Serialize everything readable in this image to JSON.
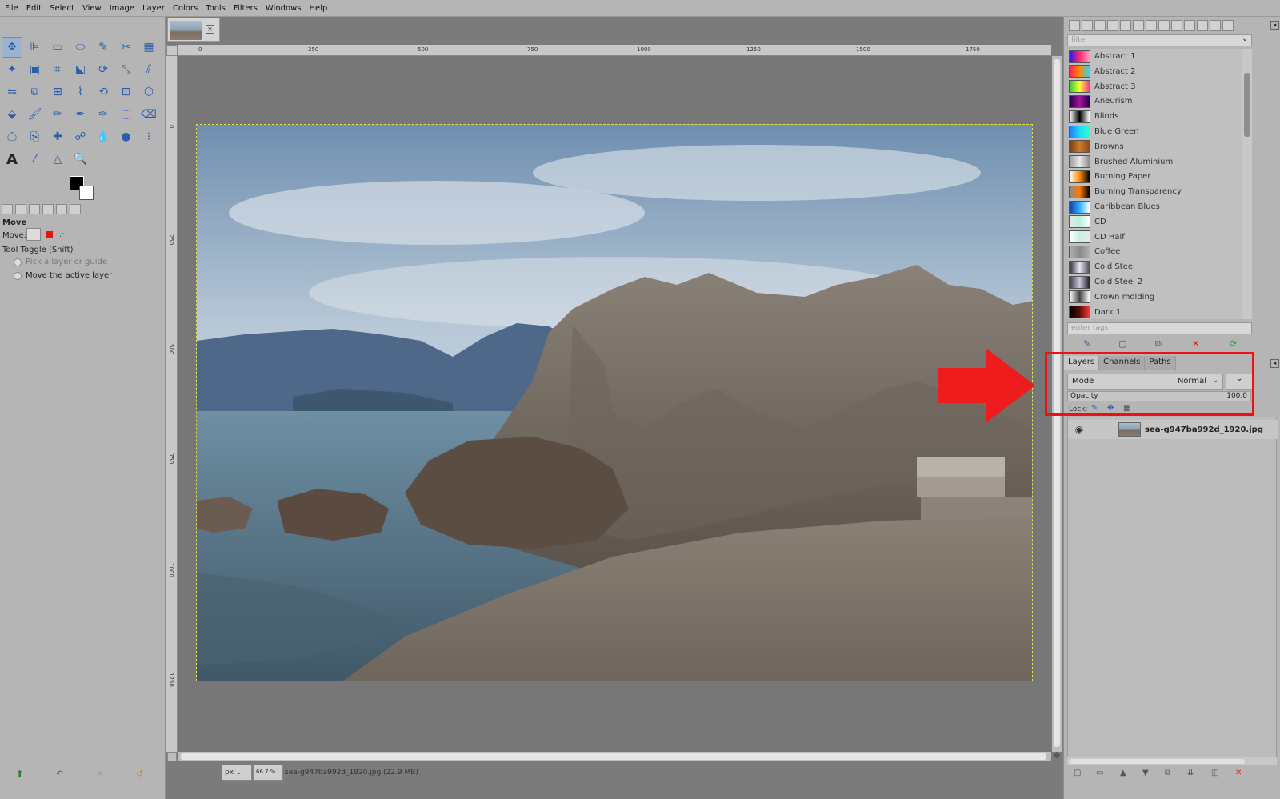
{
  "menu": [
    "File",
    "Edit",
    "Select",
    "View",
    "Image",
    "Layer",
    "Colors",
    "Tools",
    "Filters",
    "Windows",
    "Help"
  ],
  "toolbox": {
    "tools": [
      {
        "name": "move-tool-icon",
        "glyph": "✥",
        "active": true
      },
      {
        "name": "align-tool-icon",
        "glyph": "⊫"
      },
      {
        "name": "rect-select-icon",
        "glyph": "▭"
      },
      {
        "name": "ellipse-select-icon",
        "glyph": "⬭"
      },
      {
        "name": "free-select-icon",
        "glyph": "✎"
      },
      {
        "name": "scissors-select-icon",
        "glyph": "✂"
      },
      {
        "name": "foreground-select-icon",
        "glyph": "▦"
      },
      {
        "name": "fuzzy-select-icon",
        "glyph": "✦"
      },
      {
        "name": "color-select-icon",
        "glyph": "▣"
      },
      {
        "name": "crop-tool-icon",
        "glyph": "⌗"
      },
      {
        "name": "unified-transform-icon",
        "glyph": "⬕"
      },
      {
        "name": "rotate-tool-icon",
        "glyph": "⟳"
      },
      {
        "name": "scale-tool-icon",
        "glyph": "⤡"
      },
      {
        "name": "shear-tool-icon",
        "glyph": "⫽"
      },
      {
        "name": "flip-tool-icon",
        "glyph": "⇋"
      },
      {
        "name": "cage-transform-icon",
        "glyph": "⧉"
      },
      {
        "name": "perspective-tool-icon",
        "glyph": "⊞"
      },
      {
        "name": "warp-transform-icon",
        "glyph": "⌇"
      },
      {
        "name": "handle-transform-icon",
        "glyph": "⟲"
      },
      {
        "name": "n-point-deform-icon",
        "glyph": "⊡"
      },
      {
        "name": "paths-tool-icon",
        "glyph": "⬡"
      },
      {
        "name": "bucket-fill-icon",
        "glyph": "⬙"
      },
      {
        "name": "paintbrush-icon",
        "glyph": "🖌"
      },
      {
        "name": "pencil-icon",
        "glyph": "✏"
      },
      {
        "name": "airbrush-icon",
        "glyph": "✒"
      },
      {
        "name": "ink-tool-icon",
        "glyph": "✑"
      },
      {
        "name": "mypaint-brush-icon",
        "glyph": "⬚"
      },
      {
        "name": "eraser-icon",
        "glyph": "⌫"
      },
      {
        "name": "clone-tool-icon",
        "glyph": "⎙"
      },
      {
        "name": "perspective-clone-icon",
        "glyph": "⎘"
      },
      {
        "name": "heal-tool-icon",
        "glyph": "✚"
      },
      {
        "name": "smudge-tool-icon",
        "glyph": "☍"
      },
      {
        "name": "blur-tool-icon",
        "glyph": "💧"
      },
      {
        "name": "dodge-burn-icon",
        "glyph": "●"
      },
      {
        "name": "gegl-operation-icon",
        "glyph": "⁝"
      },
      {
        "name": "text-tool-icon",
        "glyph": "A"
      },
      {
        "name": "color-picker-icon",
        "glyph": "⁄"
      },
      {
        "name": "measure-tool-icon",
        "glyph": "△"
      },
      {
        "name": "zoom-tool-icon",
        "glyph": "🔍"
      }
    ],
    "tool_options": {
      "title": "Move",
      "move_label": "Move:",
      "toggle_label": "Tool Toggle  (Shift)",
      "option1": "Pick a layer or guide",
      "option2": "Move the active layer"
    }
  },
  "image_tab": {
    "close": "×"
  },
  "rulers": {
    "horizontal": [
      "0",
      "250",
      "500",
      "750",
      "1000",
      "1250",
      "1500",
      "1750"
    ],
    "vertical": [
      "0",
      "250",
      "500",
      "750",
      "1000",
      "1250"
    ]
  },
  "statusbar": {
    "unit": "px",
    "zoom": "66.7 %",
    "file": "sea-g947ba992d_1920.jpg (22.9 MB)"
  },
  "dock": {
    "filter_placeholder": "filter",
    "tags_placeholder": "enter tags",
    "gradients": [
      {
        "label": "Abstract 1",
        "colors": [
          "#1a1aff",
          "#ff2a6a",
          "#ff9cc7"
        ]
      },
      {
        "label": "Abstract 2",
        "colors": [
          "#ff1f5a",
          "#ff8a00",
          "#28d6ff"
        ]
      },
      {
        "label": "Abstract 3",
        "colors": [
          "#2ec73a",
          "#f7ff2e",
          "#ff2e8a"
        ]
      },
      {
        "label": "Aneurism",
        "colors": [
          "#22004a",
          "#a6149c",
          "#22004a"
        ]
      },
      {
        "label": "Blinds",
        "colors": [
          "#ffffff",
          "#000000",
          "#ffffff"
        ]
      },
      {
        "label": "Blue Green",
        "colors": [
          "#1e7bff",
          "#1dd9ff",
          "#2bffd0"
        ]
      },
      {
        "label": "Browns",
        "colors": [
          "#7a3d10",
          "#d07a2c",
          "#8a4a18"
        ]
      },
      {
        "label": "Brushed Aluminium",
        "colors": [
          "#9a9a9a",
          "#e8e8e8",
          "#8c8c8c"
        ]
      },
      {
        "label": "Burning Paper",
        "colors": [
          "#ffffff",
          "#ff8a00",
          "#000000"
        ]
      },
      {
        "label": "Burning Transparency",
        "colors": [
          "#8a8a8a",
          "#ff7a00",
          "#000000"
        ]
      },
      {
        "label": "Caribbean Blues",
        "colors": [
          "#0a3fa8",
          "#2fb0ff",
          "#ffffff"
        ]
      },
      {
        "label": "CD",
        "colors": [
          "#e8e8e8",
          "#b8f2d8",
          "#ffffff"
        ]
      },
      {
        "label": "CD Half",
        "colors": [
          "#ffffff",
          "#c7f0e0",
          "#e8e8e8"
        ]
      },
      {
        "label": "Coffee",
        "colors": [
          "#b0b0b0",
          "#8a8a8a",
          "#b0b0b0"
        ]
      },
      {
        "label": "Cold Steel",
        "colors": [
          "#2c2c3c",
          "#e8e8f0",
          "#4a4a5a"
        ]
      },
      {
        "label": "Cold Steel 2",
        "colors": [
          "#3a3a4a",
          "#c9c9d9",
          "#1e1e2a"
        ]
      },
      {
        "label": "Crown molding",
        "colors": [
          "#ffffff",
          "#444444",
          "#ffffff"
        ]
      },
      {
        "label": "Dark 1",
        "colors": [
          "#000000",
          "#5a0a0a",
          "#ff3a3a"
        ]
      }
    ],
    "layer_tabs": [
      "Layers",
      "Channels",
      "Paths"
    ],
    "mode_label": "Mode",
    "mode_value": "Normal",
    "opacity_label": "Opacity",
    "opacity_value": "100.0",
    "lock_label": "Lock:",
    "layer_name": "sea-g947ba992d_1920.jpg"
  },
  "colors": {
    "highlight": "#e11111",
    "panel": "#b5b5b5",
    "canvas_bg": "#777777"
  }
}
